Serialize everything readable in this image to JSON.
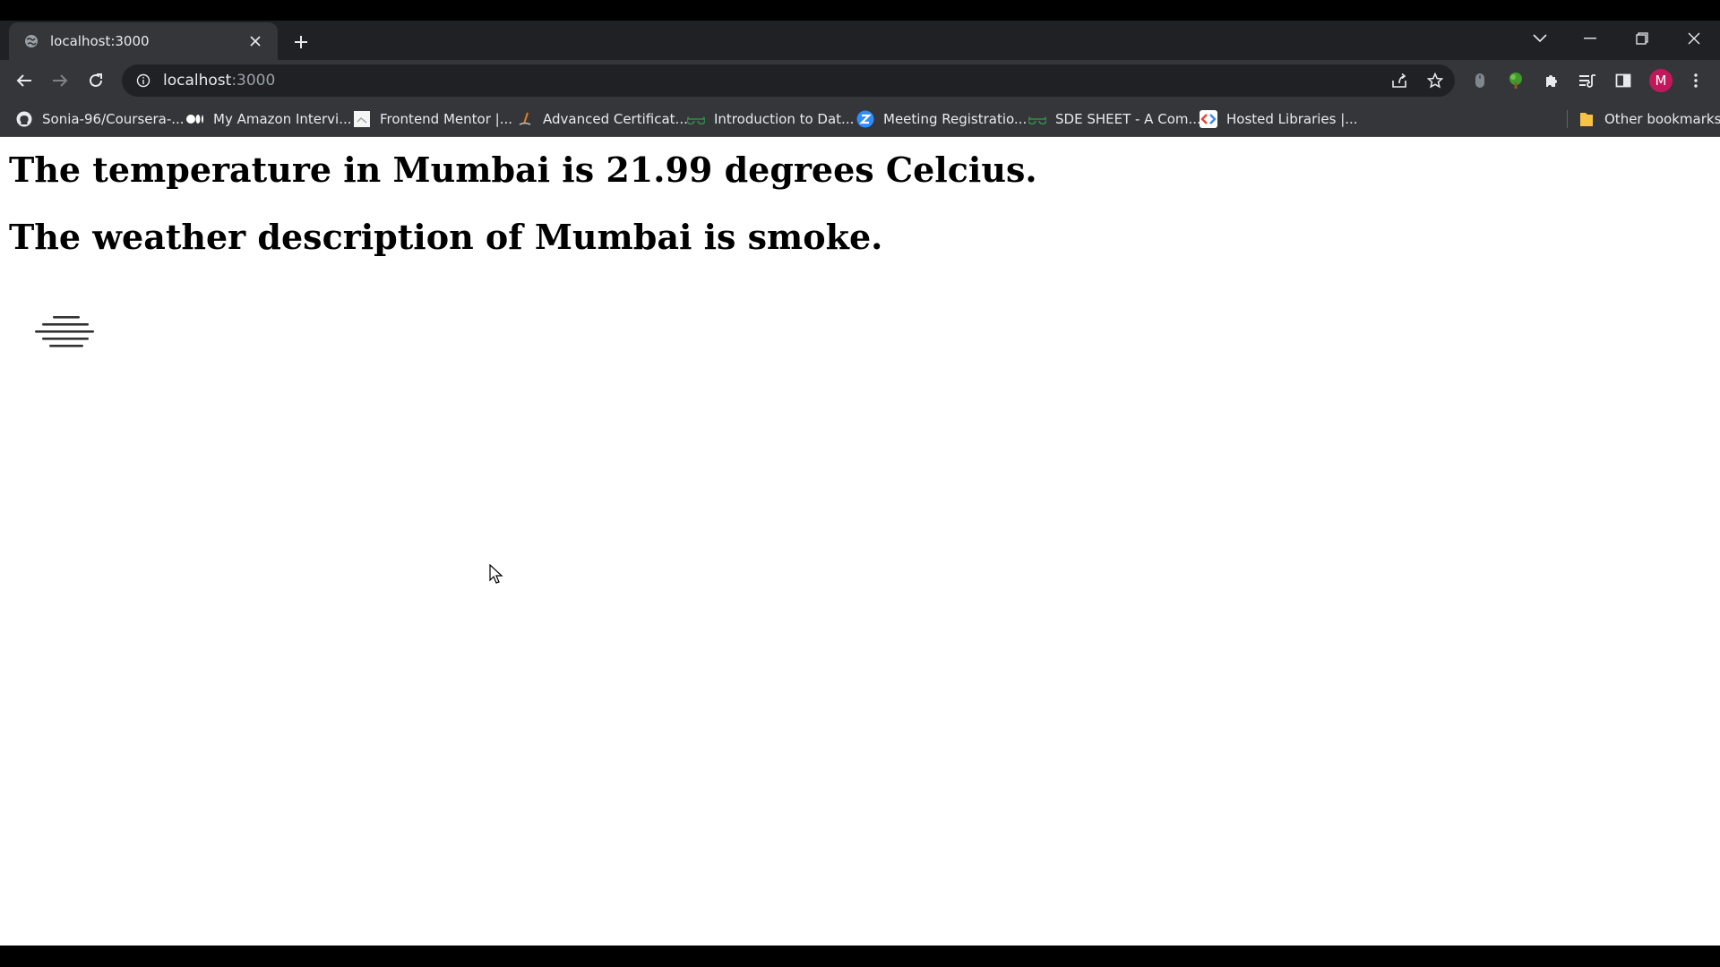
{
  "browser": {
    "tab": {
      "title": "localhost:3000",
      "favicon": "globe-icon"
    },
    "omnibox": {
      "host": "localhost",
      "port": ":3000"
    },
    "profile_initial": "M",
    "bookmarks": [
      {
        "label": "Sonia-96/Coursera-...",
        "icon": "github-icon"
      },
      {
        "label": "My Amazon Intervi...",
        "icon": "medium-icon"
      },
      {
        "label": "Frontend Mentor |...",
        "icon": "frontend-mentor-icon"
      },
      {
        "label": "Advanced Certificat...",
        "icon": "certificate-icon"
      },
      {
        "label": "Introduction to Dat...",
        "icon": "gfg-icon"
      },
      {
        "label": "Meeting Registratio...",
        "icon": "zoom-icon"
      },
      {
        "label": "SDE SHEET - A Com...",
        "icon": "gfg-icon"
      },
      {
        "label": "Hosted Libraries |...",
        "icon": "google-dev-icon"
      }
    ],
    "other_bookmarks": "Other bookmarks"
  },
  "page": {
    "temperature_text": "The temperature in Mumbai is 21.99 degrees Celcius.",
    "description_text": "The weather description of Mumbai is smoke.",
    "weather_icon": "smoke-mist-icon"
  },
  "colors": {
    "titlebar": "#202124",
    "toolbar": "#35363a",
    "avatar": "#c2185b",
    "page_background": "#ffffff"
  }
}
